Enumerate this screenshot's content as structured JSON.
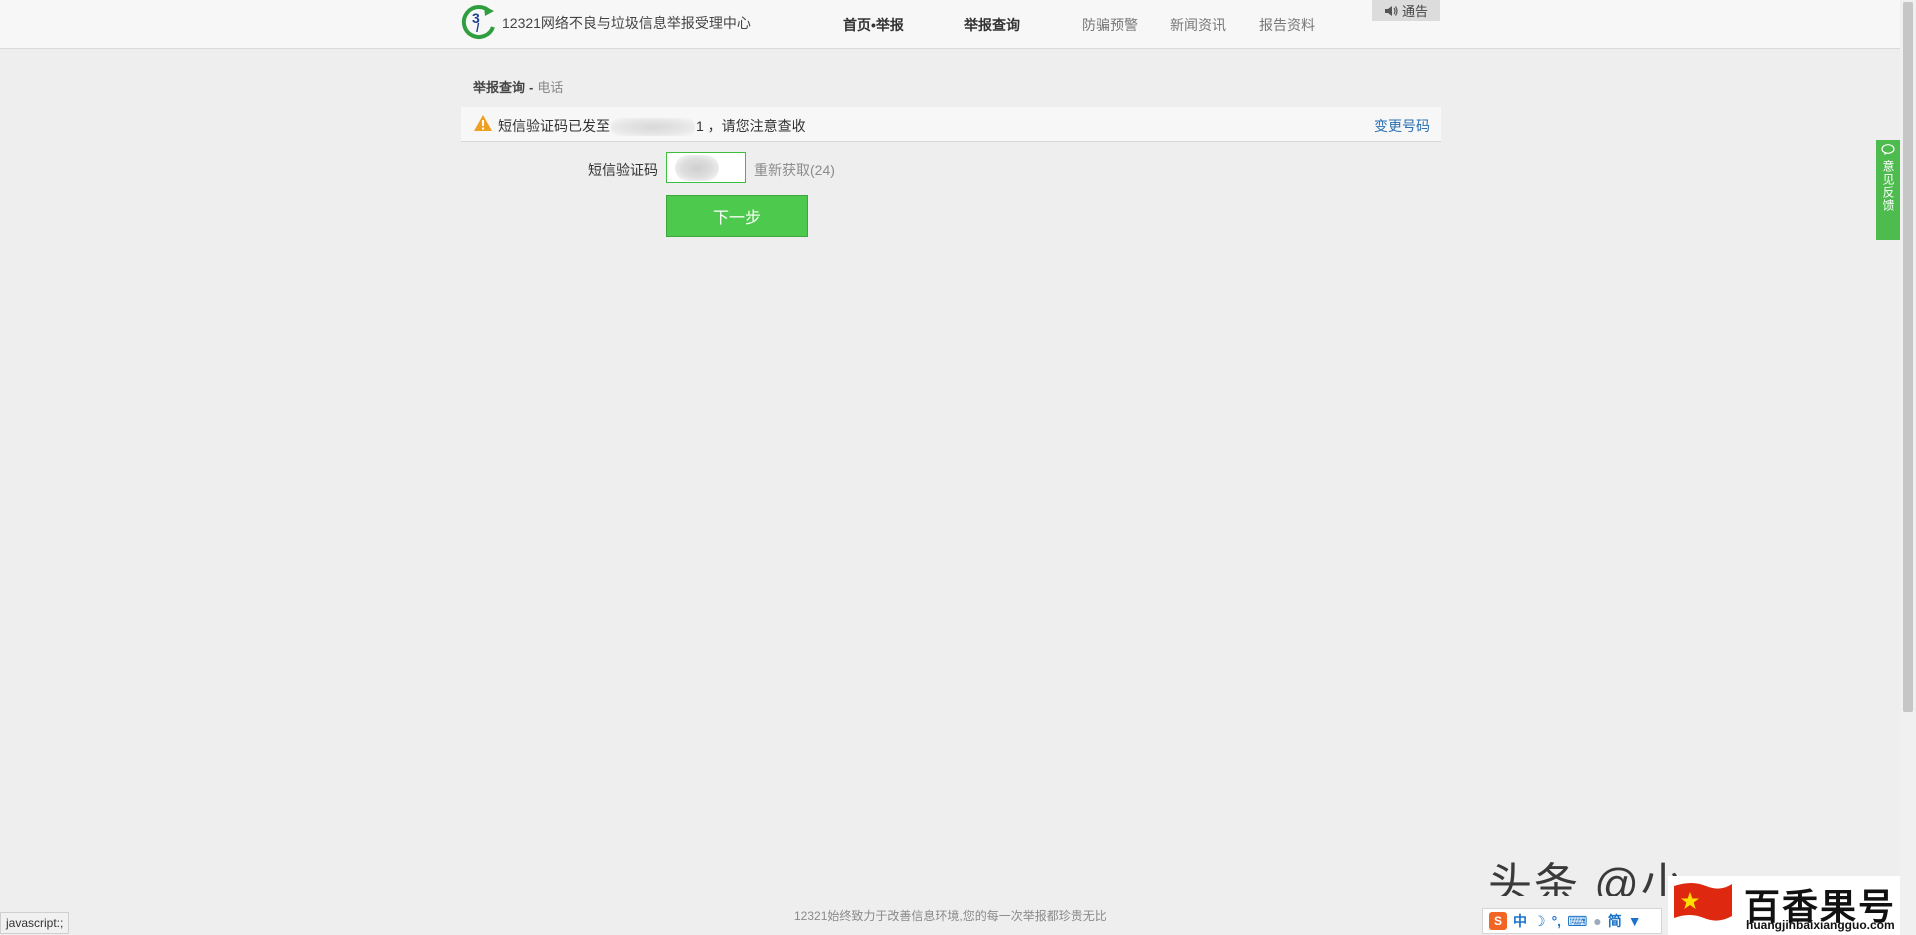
{
  "header": {
    "site_name": "12321网络不良与垃圾信息举报受理中心",
    "nav": [
      {
        "label": "首页•举报"
      },
      {
        "label": "举报查询"
      },
      {
        "label": "防骗预警"
      },
      {
        "label": "新闻资讯"
      },
      {
        "label": "报告资料"
      }
    ],
    "notice_label": "通告"
  },
  "breadcrumb": {
    "main": "举报查询",
    "separator": "-",
    "sub": "电话"
  },
  "alert": {
    "prefix": "短信验证码已发至",
    "suffix": "1 ，请您注意查收",
    "change_number": "变更号码"
  },
  "form": {
    "code_label": "短信验证码",
    "code_value": "0",
    "resend_label": "重新获取(24)",
    "next_label": "下一步"
  },
  "feedback": {
    "label": "意见反馈"
  },
  "footer": {
    "slogan": "12321始终致力于改善信息环境,您的每一次举报都珍贵无比"
  },
  "status_bar": {
    "text": "javascript:;"
  },
  "watermarks": {
    "toutiao": "头条 @小",
    "brand": "百香果号",
    "url": "huangjinbaixiangguo.com",
    "ime_items": [
      "中",
      "简"
    ]
  },
  "colors": {
    "accent_green": "#4dc94d",
    "link_blue": "#2a6fb0",
    "warning_orange": "#f0a020"
  }
}
